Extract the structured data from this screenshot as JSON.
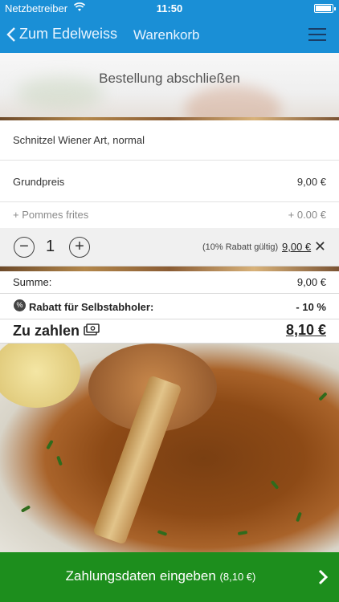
{
  "status_bar": {
    "carrier": "Netzbetreiber",
    "time": "11:50"
  },
  "nav": {
    "back_label": "Zum Edelweiss",
    "title": "Warenkorb"
  },
  "hero": {
    "heading": "Bestellung abschließen"
  },
  "item": {
    "name": "Schnitzel Wiener Art, normal",
    "base_label": "Grundpreis",
    "base_price": "9,00 €",
    "extra_label": "+ Pommes frites",
    "extra_price": "+ 0.00 €",
    "quantity": "1",
    "discount_note": "(10% Rabatt gültig)",
    "line_price": "9,00 €"
  },
  "summary": {
    "sum_label": "Summe:",
    "sum_value": "9,00 €",
    "discount_label": "Rabatt für Selbstabholer:",
    "discount_value": "- 10 %",
    "total_label": "Zu zahlen",
    "total_value": "8,10 €"
  },
  "cta": {
    "label": "Zahlungsdaten eingeben",
    "amount": "(8,10 €)"
  },
  "colors": {
    "nav": "#1a8fd6",
    "cta": "#1d8e1d"
  },
  "icons": [
    "wifi-icon",
    "battery-icon",
    "chevron-left-icon",
    "hamburger-menu-icon",
    "minus-icon",
    "plus-icon",
    "close-icon",
    "discount-badge-icon",
    "cash-icon",
    "chevron-right-icon"
  ]
}
